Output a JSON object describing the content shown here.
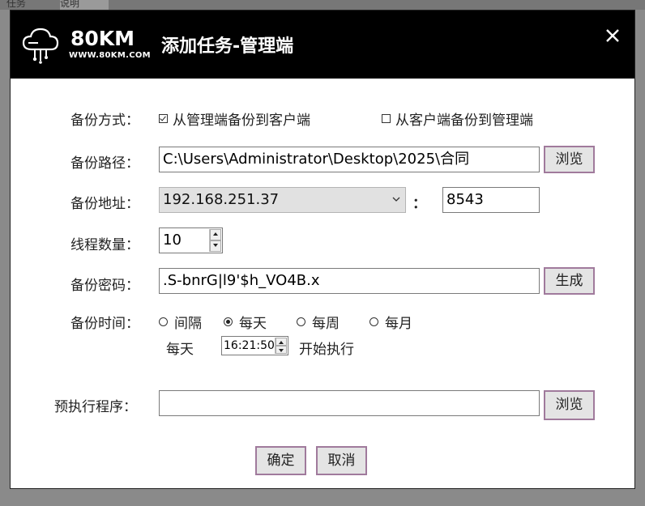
{
  "background_tabs": [
    "任务",
    "说明"
  ],
  "window": {
    "brand": "80KM",
    "brand_url": "WWW.80KM.COM",
    "title": "添加任务-管理端",
    "close_symbol": "✕"
  },
  "form": {
    "mode_label": "备份方式：",
    "mode_options": [
      {
        "label": "从管理端备份到客户端",
        "checked": true
      },
      {
        "label": "从客户端备份到管理端",
        "checked": false
      }
    ],
    "path_label": "备份路径：",
    "path_value": "C:\\Users\\Administrator\\Desktop\\2025\\合同",
    "browse_label": "浏览",
    "address_label": "备份地址：",
    "address_value": "192.168.251.37",
    "colon": "：",
    "port_value": "8543",
    "threads_label": "线程数量：",
    "threads_value": "10",
    "password_label": "备份密码：",
    "password_value": ".S-bnrG|l9'$h_VO4B.x",
    "generate_label": "生成",
    "time_label": "备份时间：",
    "time_options": [
      {
        "label": "间隔",
        "checked": false
      },
      {
        "label": "每天",
        "checked": true
      },
      {
        "label": "每周",
        "checked": false
      },
      {
        "label": "每月",
        "checked": false
      }
    ],
    "daily_label": "每天",
    "time_value": "16:21:50",
    "start_label": "开始执行",
    "pre_program_label": "预执行程序：",
    "pre_program_value": "",
    "browse2_label": "浏览",
    "ok_label": "确定",
    "cancel_label": "取消"
  }
}
